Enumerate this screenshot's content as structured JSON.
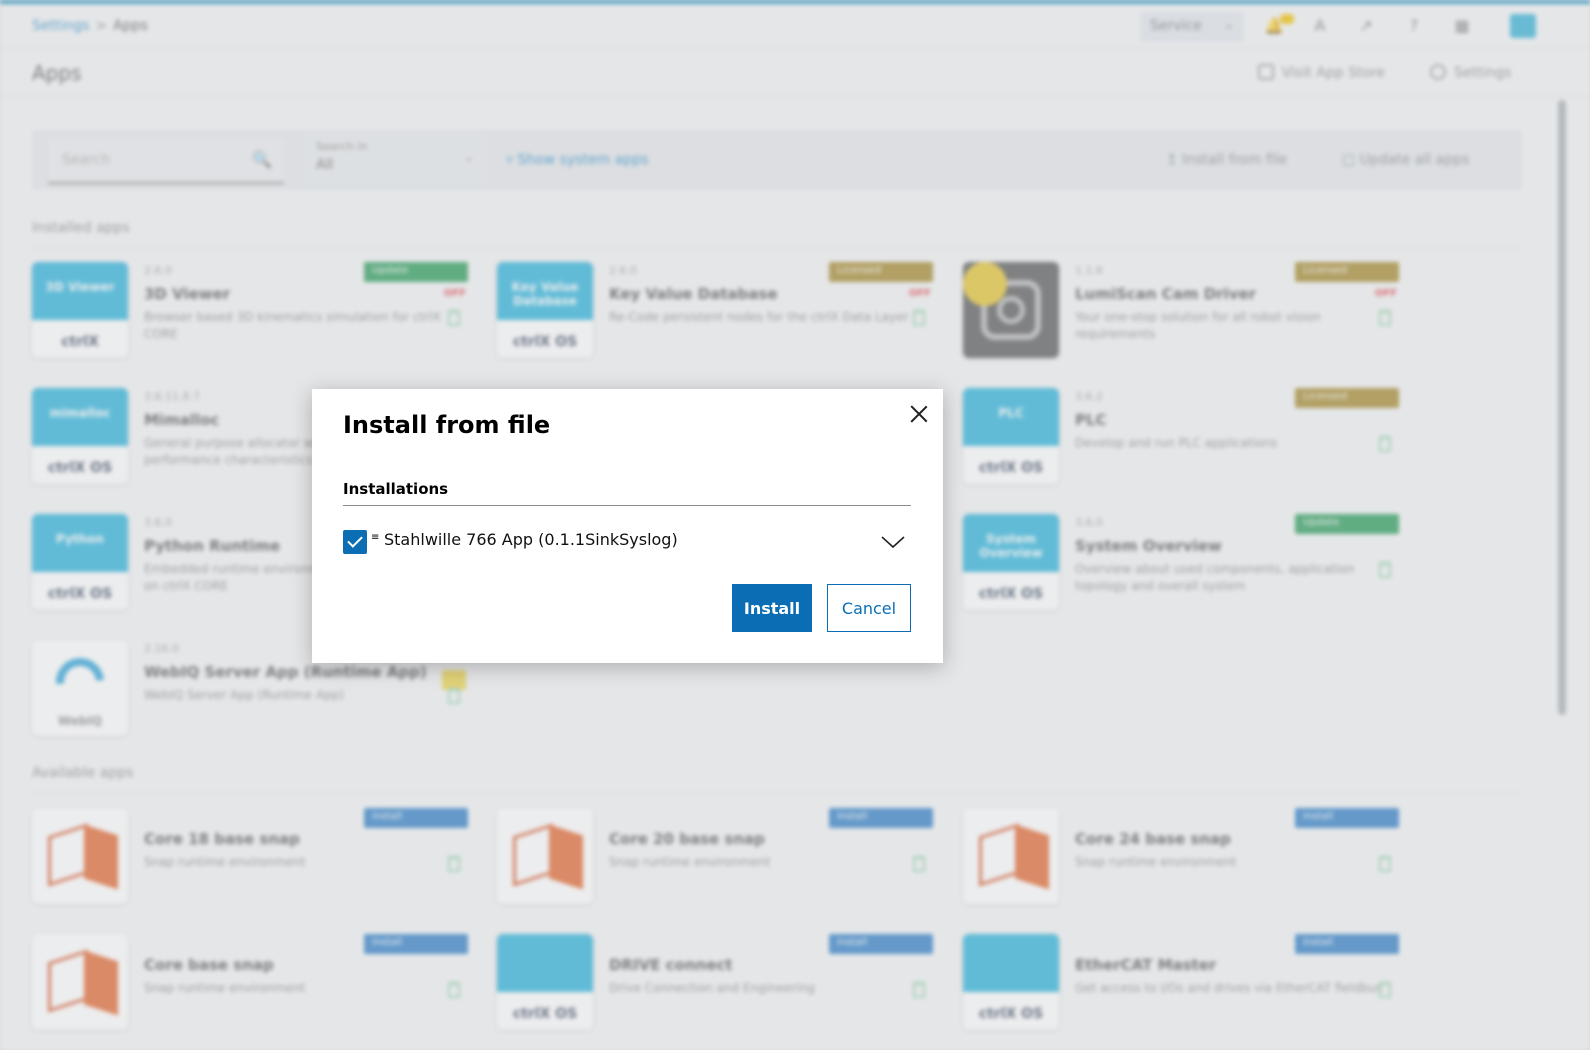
{
  "background": {
    "breadcrumb": {
      "root": "Settings",
      "separator": ">",
      "current": "Apps"
    },
    "user_menu": "Service",
    "page_title": "Apps",
    "header_links": {
      "app_store": "Visit App Store",
      "settings": "Settings"
    },
    "toolbar": {
      "search_placeholder": "Search",
      "search_in_label": "Search in",
      "search_in_value": "All",
      "show_system_apps": "Show system apps",
      "install_from_file": "Install from file",
      "update_all": "Update all apps"
    },
    "installed_label": "Installed apps",
    "available_label": "Available apps",
    "installed_apps": [
      {
        "version": "2.6.0",
        "name": "3D Viewer",
        "desc": "Browser based 3D kinematics simulation for ctrlX CORE",
        "thumb": "3D Viewer",
        "badge": "Update",
        "badge_color": "green",
        "red": "OFF"
      },
      {
        "version": "2.6.0",
        "name": "Key Value Database",
        "desc": "Re-Code persistent nodes for the ctrlX Data Layer",
        "thumb": "Key Value Database",
        "badge": "Licensed",
        "badge_color": "gold",
        "red": "OFF"
      },
      {
        "version": "1.1.6",
        "name": "LumiScan Cam Driver",
        "desc": "Your one-stop solution for all robot vision requirements",
        "thumb": "",
        "badge": "Licensed",
        "badge_color": "gold",
        "red": "OFF"
      },
      {
        "version": "3.6.11.8.7",
        "name": "Mimalloc",
        "desc": "General purpose allocator with excellent performance characteristics",
        "thumb": "mimalloc",
        "badge": "",
        "badge_color": "",
        "red": ""
      },
      {
        "version": "3.6.2",
        "name": "PLC",
        "desc": "Develop and run PLC applications",
        "thumb": "PLC",
        "badge": "Licensed",
        "badge_color": "gold",
        "red": ""
      },
      {
        "version": "3.6.0",
        "name": "Python Runtime",
        "desc": "Embedded runtime environment for Python scripts on ctrlX CORE",
        "thumb": "Python",
        "badge": "",
        "badge_color": "",
        "red": ""
      },
      {
        "version": "3.6.0",
        "name": "System Overview",
        "desc": "Overview about used components, application topology and overall system",
        "thumb": "System Overview",
        "badge": "Update",
        "badge_color": "green",
        "red": ""
      },
      {
        "version": "2.16.0",
        "name": "WebIQ Server App (Runtime App)",
        "desc": "WebIQ Server App (Runtime App)",
        "thumb": "",
        "badge": "",
        "badge_color": "",
        "red": ""
      }
    ],
    "available_apps": [
      {
        "name": "Core 18 base snap",
        "desc": "Snap runtime environment",
        "badge": "Install"
      },
      {
        "name": "Core 20 base snap",
        "desc": "Snap runtime environment",
        "badge": "Install"
      },
      {
        "name": "Core 24 base snap",
        "desc": "Snap runtime environment",
        "badge": "Install"
      },
      {
        "name": "Core base snap",
        "desc": "Snap runtime environment",
        "badge": "Install"
      },
      {
        "name": "DRIVE connect",
        "desc": "Drive Connection and Engineering",
        "badge": "Install"
      },
      {
        "name": "EtherCAT Master",
        "desc": "Get access to I/Os and drives via EtherCAT fieldbus",
        "badge": "Install"
      }
    ],
    "thumb_footer": "ctrlX OS",
    "thumb_footer_ctrlx": "ctrlX",
    "thumb_footer_webiq": "WebIQ",
    "colors": {
      "accent": "#2ab3dc",
      "primary": "#0b6eb4"
    }
  },
  "dialog": {
    "title": "Install from file",
    "section": "Installations",
    "item_icon": "list-icon",
    "item_label": "Stahlwille 766 App (0.1.1SinkSyslog)",
    "checked": true,
    "install_label": "Install",
    "cancel_label": "Cancel"
  }
}
